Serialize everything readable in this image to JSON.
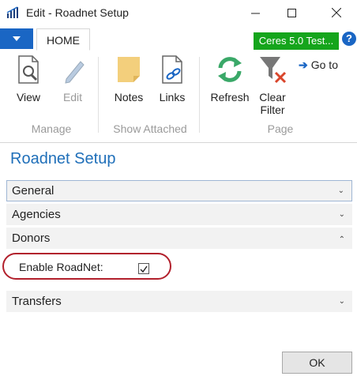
{
  "window": {
    "title": "Edit - Roadnet Setup"
  },
  "ribbon": {
    "tab_home": "HOME",
    "company": "Ceres 5.0 Test...",
    "help": "?",
    "buttons": {
      "view": "View",
      "edit": "Edit",
      "notes": "Notes",
      "links": "Links",
      "refresh": "Refresh",
      "clear_filter_1": "Clear",
      "clear_filter_2": "Filter",
      "goto": "Go to"
    },
    "groups": {
      "manage": "Manage",
      "show_attached": "Show Attached",
      "page": "Page"
    }
  },
  "page": {
    "title": "Roadnet Setup",
    "fasttabs": [
      "General",
      "Agencies",
      "Donors",
      "Transfers"
    ],
    "donors_fields": {
      "enable_roadnet_label": "Enable RoadNet:",
      "enable_roadnet_checked": true
    }
  },
  "footer": {
    "ok": "OK"
  },
  "colors": {
    "accent": "#1a66c4",
    "title_blue": "#1f6fb9",
    "company_badge": "#15a51c",
    "highlight": "#b2202c"
  }
}
